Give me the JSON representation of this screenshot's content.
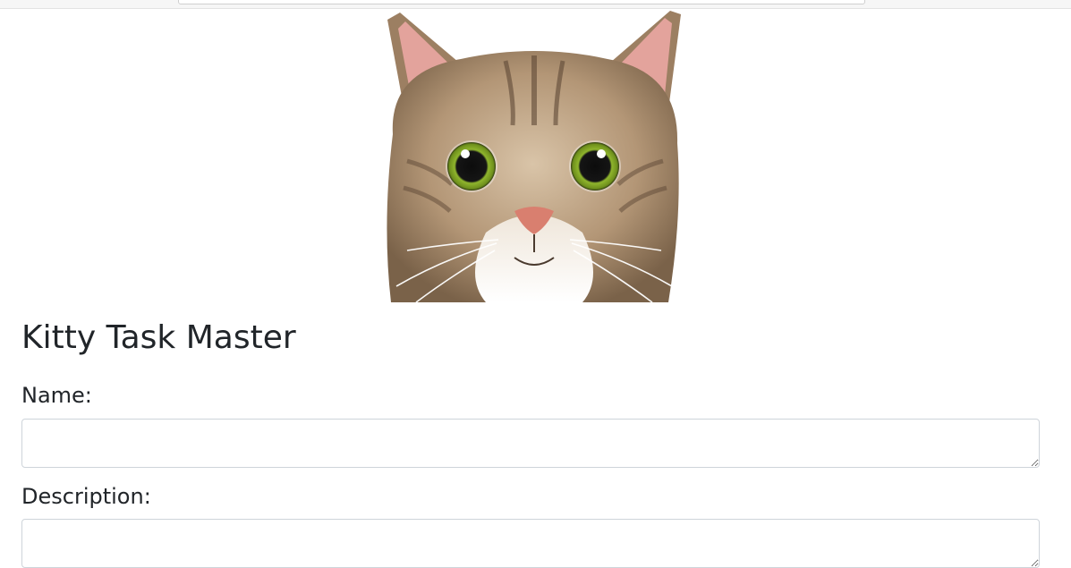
{
  "app": {
    "title": "Kitty Task Master"
  },
  "hero_image": {
    "subject": "tabby-cat-face",
    "colors": {
      "fur": "#b79a78",
      "fur_dark": "#6f5a44",
      "ear_inner": "#e7a7a2",
      "eye_iris": "#8fb52d",
      "nose": "#d97f6f"
    }
  },
  "form": {
    "name_label": "Name:",
    "name_value": "",
    "description_label": "Description:",
    "description_value": ""
  }
}
